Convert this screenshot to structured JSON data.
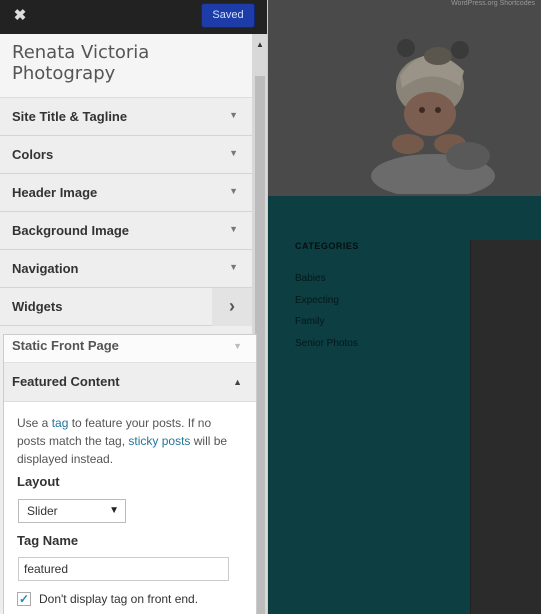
{
  "topbar": {
    "close_symbol": "✖",
    "save_label": "Saved"
  },
  "site": {
    "title": "Renata Victoria Photograpy"
  },
  "sections": [
    {
      "label": "Site Title & Tagline"
    },
    {
      "label": "Colors"
    },
    {
      "label": "Header Image"
    },
    {
      "label": "Background Image"
    },
    {
      "label": "Navigation"
    },
    {
      "label": "Widgets"
    }
  ],
  "static_front_page": {
    "label": "Static Front Page"
  },
  "featured": {
    "label": "Featured Content",
    "desc_part1": "Use a ",
    "desc_link1": "tag",
    "desc_part2": " to feature your posts. If no posts match the tag, ",
    "desc_link2": "sticky posts",
    "desc_part3": " will be displayed instead.",
    "layout_label": "Layout",
    "layout_value": "Slider",
    "tag_label": "Tag Name",
    "tag_value": "featured",
    "hide_tag_label": "Don't display tag on front end.",
    "hide_tag_checked": true
  },
  "preview": {
    "top_hint": "WordPress.org Shortcodes",
    "categories_heading": "CATEGORIES",
    "categories": [
      "Babies",
      "Expecting",
      "Family",
      "Senior Photos"
    ]
  }
}
